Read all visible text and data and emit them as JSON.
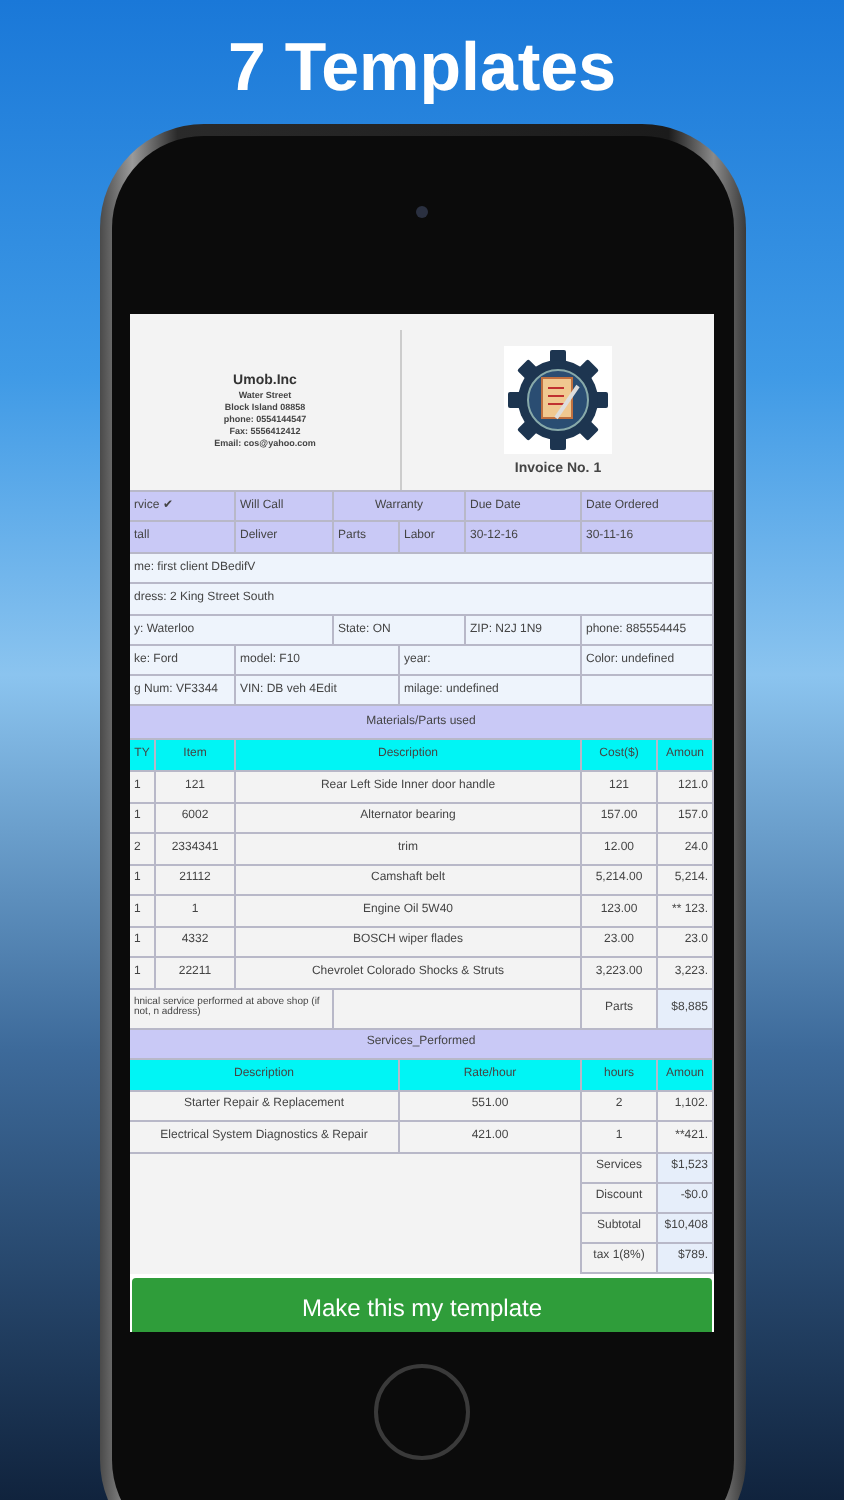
{
  "headline": "7 Templates",
  "invoice": {
    "company": {
      "name": "Umob.Inc",
      "lines": [
        "Water Street",
        "Block Island 08858",
        "phone: 0554144547",
        "Fax: 5556412412",
        "Email: cos@yahoo.com"
      ]
    },
    "invoice_number": "Invoice No. 1",
    "order_row_1": [
      "rvice ✔",
      "Will Call",
      "Warranty",
      "Due Date",
      "Date Ordered"
    ],
    "order_row_2": [
      "tall",
      "Deliver",
      "Parts",
      "Labor",
      "30-12-16",
      "30-11-16"
    ],
    "customer_name": "me: first client DBedifV",
    "customer_address": "dress: 2 King Street South",
    "city_row": [
      "y: Waterloo",
      "State: ON",
      "ZIP: N2J 1N9",
      "phone: 885554445"
    ],
    "vehicle_row_1": [
      "ke: Ford",
      "model: F10",
      "year:",
      "Color: undefined"
    ],
    "vehicle_row_2": [
      "g Num: VF3344",
      "VIN: DB veh 4Edit",
      "milage: undefined"
    ],
    "materials_title": "Materials/Parts used",
    "materials_columns": [
      "TY",
      "Item",
      "Description",
      "Cost($)",
      "Amoun"
    ],
    "materials_rows": [
      {
        "qty": "1",
        "item": "121",
        "description": "Rear Left Side Inner door handle",
        "cost": "121",
        "amount": "121.0"
      },
      {
        "qty": "1",
        "item": "6002",
        "description": "Alternator bearing",
        "cost": "157.00",
        "amount": "157.0"
      },
      {
        "qty": "2",
        "item": "2334341",
        "description": "trim",
        "cost": "12.00",
        "amount": "24.0"
      },
      {
        "qty": "1",
        "item": "21112",
        "description": "Camshaft belt",
        "cost": "5,214.00",
        "amount": "5,214."
      },
      {
        "qty": "1",
        "item": "1",
        "description": "Engine Oil 5W40",
        "cost": "123.00",
        "amount": "** 123."
      },
      {
        "qty": "1",
        "item": "4332",
        "description": "BOSCH wiper flades",
        "cost": "23.00",
        "amount": "23.0"
      },
      {
        "qty": "1",
        "item": "22211",
        "description": "Chevrolet Colorado Shocks & Struts",
        "cost": "3,223.00",
        "amount": "3,223."
      }
    ],
    "parts_note": "hnical service performed at above shop (if not, n address)",
    "parts_label": "Parts",
    "parts_total": "$8,885",
    "services_title": "Services_Performed",
    "services_columns": [
      "Description",
      "Rate/hour",
      "hours",
      "Amoun"
    ],
    "services_rows": [
      {
        "description": "Starter Repair & Replacement",
        "rate": "551.00",
        "hours": "2",
        "amount": "1,102."
      },
      {
        "description": "Electrical System Diagnostics & Repair",
        "rate": "421.00",
        "hours": "1",
        "amount": "**421."
      }
    ],
    "totals": [
      {
        "label": "Services",
        "value": "$1,523"
      },
      {
        "label": "Discount",
        "value": "-$0.0"
      },
      {
        "label": "Subtotal",
        "value": "$10,408"
      },
      {
        "label": "tax 1(8%)",
        "value": "$789."
      }
    ]
  },
  "button": "Make this my template"
}
